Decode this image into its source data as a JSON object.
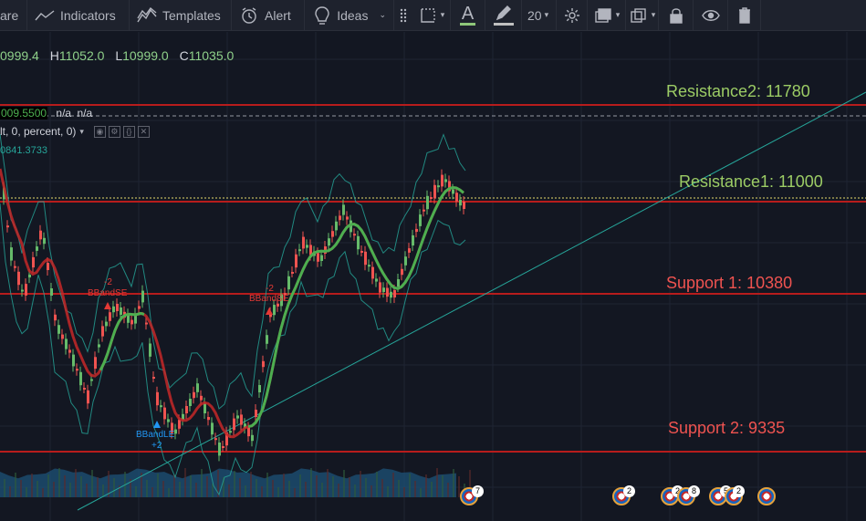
{
  "toolbar": {
    "compare_label": "are",
    "indicators_label": "Indicators",
    "templates_label": "Templates",
    "alert_label": "Alert",
    "ideas_label": "Ideas",
    "font_letter": "A",
    "font_size": "20",
    "icons": [
      "indicators-icon",
      "templates-icon",
      "alert-icon",
      "ideas-icon",
      "drag-handle-icon",
      "selection-frame-icon",
      "text-color-icon",
      "pencil-icon",
      "settings-gear-icon",
      "fill-icon",
      "clone-icon",
      "lock-icon",
      "eye-icon",
      "trash-icon"
    ]
  },
  "legend": {
    "o_value": "0999.4",
    "h_key": "H",
    "h_value": "11052.0",
    "l_key": "L",
    "l_value": "10999.0",
    "c_key": "C",
    "c_value": "11035.0",
    "ind1_value": "009.5500",
    "ind1_na1": "n/a",
    "ind1_na2": "n/a",
    "ind2_text": "lt, 0, percent, 0)",
    "ind3_value": "0841.3733"
  },
  "levels": {
    "resistance2": "Resistance2: 11780",
    "resistance1": "Resistance1: 11000",
    "support1": "Support 1: 10380",
    "support2": "Support 2: 9335"
  },
  "bb_labels": {
    "sell_count_1": "-2",
    "sell_label_1": "BBandSE",
    "sell_count_2": "-2",
    "sell_label_2": "BBandSE",
    "buy_label": "BBandLE",
    "buy_count": "+2"
  },
  "events": {
    "badges": [
      "7",
      "2",
      "2",
      "8",
      "5",
      "2"
    ]
  },
  "colors": {
    "background": "#131722",
    "resistance_line": "#b71c1c",
    "up_candle": "#66bb6a",
    "down_candle": "#ef5350",
    "ma_green": "#4caf50",
    "ma_red": "#c62828",
    "band": "#26a69a"
  }
}
